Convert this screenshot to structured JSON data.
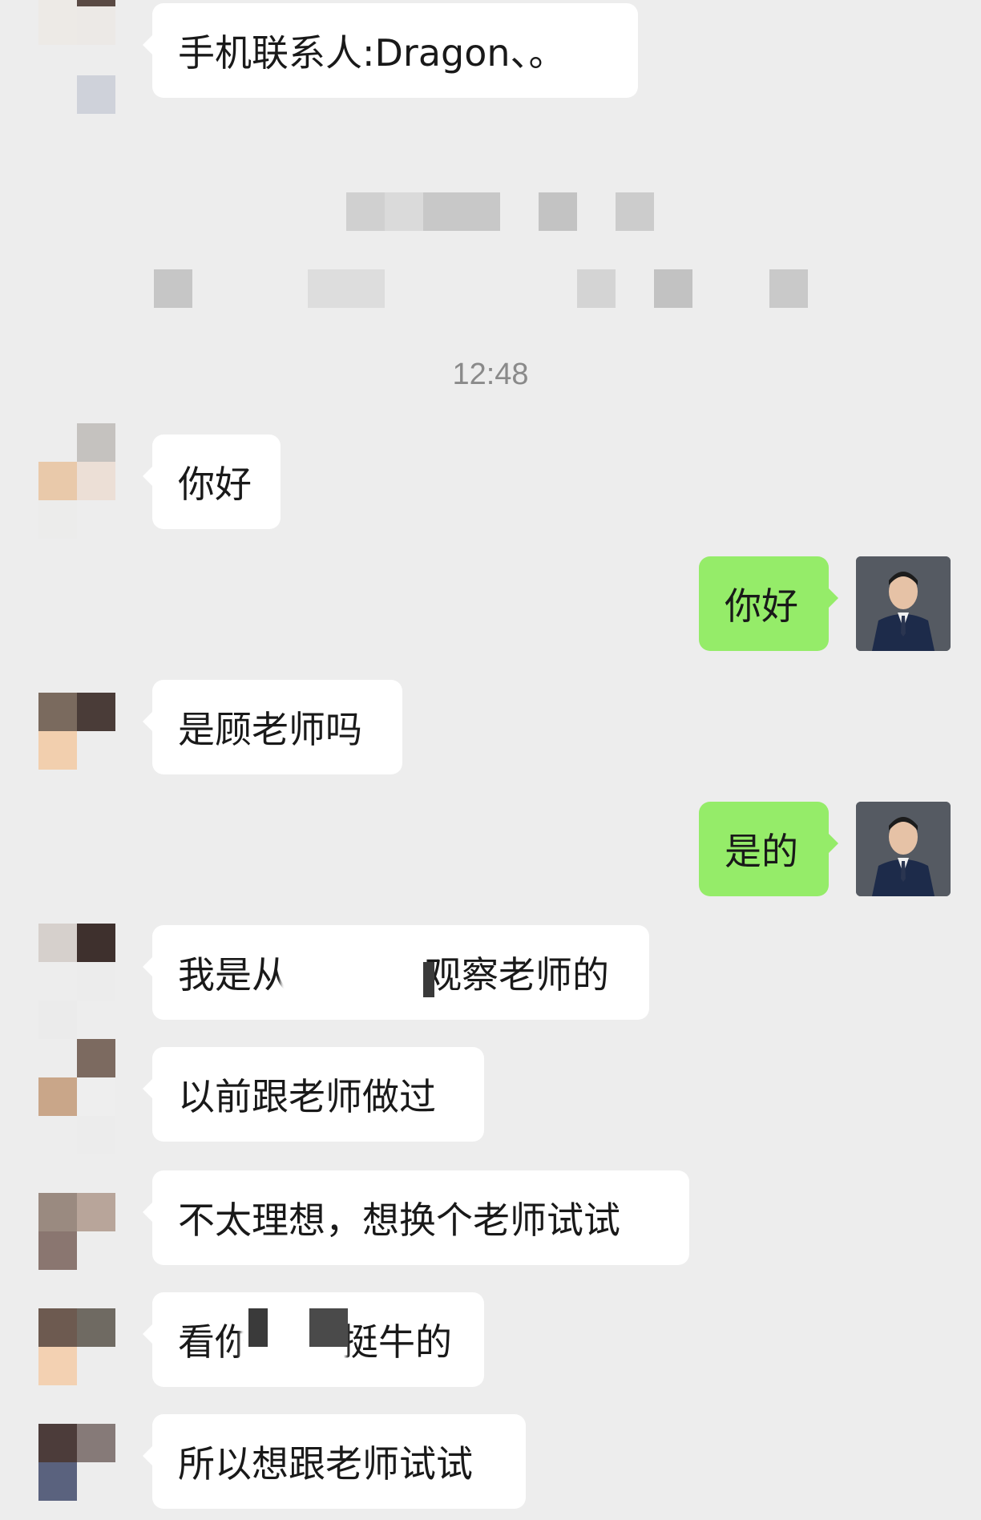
{
  "colors": {
    "background": "#ededed",
    "incoming_bubble": "#ffffff",
    "outgoing_bubble": "#95ec69",
    "text": "#191919",
    "timestamp": "#8a8a8a"
  },
  "messages": {
    "contact_card": "手机联系人:Dragon、。",
    "timestamp": "12:48",
    "m1": "你好",
    "m2_out": "你好",
    "m3": "是顾老师吗",
    "m4_out": "是的",
    "m5_part1": "我是从",
    "m5_part2": "观察老师的",
    "m6": "以前跟老师做过",
    "m7": "不太理想，想换个老师试试",
    "m8_part1": "看你",
    "m8_part2": "挺牛的",
    "m9": "所以想跟老师试试"
  }
}
